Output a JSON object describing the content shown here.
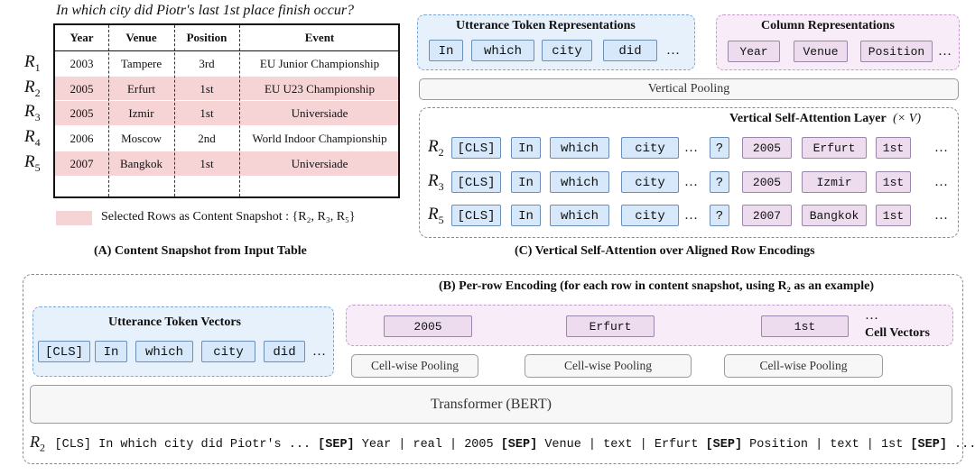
{
  "question": "In which city did Piotr's last 1st place finish occur?",
  "table": {
    "headers": [
      "Year",
      "Venue",
      "Position",
      "Event"
    ],
    "rows": [
      {
        "label": "R",
        "sub": "1",
        "cells": [
          "2003",
          "Tampere",
          "3rd",
          "EU Junior Championship"
        ],
        "selected": false
      },
      {
        "label": "R",
        "sub": "2",
        "cells": [
          "2005",
          "Erfurt",
          "1st",
          "EU U23 Championship"
        ],
        "selected": true
      },
      {
        "label": "R",
        "sub": "3",
        "cells": [
          "2005",
          "Izmir",
          "1st",
          "Universiade"
        ],
        "selected": true
      },
      {
        "label": "R",
        "sub": "4",
        "cells": [
          "2006",
          "Moscow",
          "2nd",
          "World Indoor Championship"
        ],
        "selected": false
      },
      {
        "label": "R",
        "sub": "5",
        "cells": [
          "2007",
          "Bangkok",
          "1st",
          "Universiade"
        ],
        "selected": true
      }
    ]
  },
  "legend_text": "Selected Rows as Content Snapshot : {R₂, R₃, R₅}",
  "caption_a": "(A) Content Snapshot from Input Table",
  "caption_c": "(C) Vertical Self-Attention over Aligned Row Encodings",
  "utterance_reps": {
    "title": "Utterance Token Representations",
    "tokens": [
      "In",
      "which",
      "city",
      "did"
    ],
    "ellipsis": "…"
  },
  "column_reps": {
    "title": "Column Representations",
    "tokens": [
      "Year",
      "Venue",
      "Position"
    ],
    "ellipsis": "…"
  },
  "vertical_pooling": "Vertical Pooling",
  "vsa": {
    "title": "Vertical Self-Attention Layer",
    "times": "(× V)",
    "rows": [
      {
        "label": "R",
        "sub": "2",
        "tokens": [
          "[CLS]",
          "In",
          "which",
          "city"
        ],
        "q": "?",
        "cells": [
          "2005",
          "Erfurt",
          "1st"
        ]
      },
      {
        "label": "R",
        "sub": "3",
        "tokens": [
          "[CLS]",
          "In",
          "which",
          "city"
        ],
        "q": "?",
        "cells": [
          "2005",
          "Izmir",
          "1st"
        ]
      },
      {
        "label": "R",
        "sub": "5",
        "tokens": [
          "[CLS]",
          "In",
          "which",
          "city"
        ],
        "q": "?",
        "cells": [
          "2007",
          "Bangkok",
          "1st"
        ]
      }
    ],
    "ellipsis": "…"
  },
  "per_row": {
    "title": "(B) Per-row Encoding (for each row in content snapshot, using R₂ as an example)",
    "utt_vectors_title": "Utterance Token Vectors",
    "utt_tokens": [
      "[CLS]",
      "In",
      "which",
      "city",
      "did"
    ],
    "cells": [
      "2005",
      "Erfurt",
      "1st"
    ],
    "cell_vectors_label": "Cell Vectors",
    "cell_pooling": "Cell-wise Pooling",
    "transformer": "Transformer (BERT)",
    "seq_label": "R",
    "seq_sub": "2",
    "sequence": [
      {
        "t": "[CLS] In which city did Piotr's ... ",
        "b": false
      },
      {
        "t": "[SEP]",
        "b": true
      },
      {
        "t": " Year | real | 2005 ",
        "b": false
      },
      {
        "t": "[SEP]",
        "b": true
      },
      {
        "t": " Venue | text | Erfurt ",
        "b": false
      },
      {
        "t": "[SEP]",
        "b": true
      },
      {
        "t": " Position | text | 1st ",
        "b": false
      },
      {
        "t": "[SEP]",
        "b": true
      },
      {
        "t": " ...",
        "b": false
      }
    ]
  },
  "colors": {
    "blue_token": "#d6e8fa",
    "purple_token": "#ecdcee",
    "highlight_row": "#f6d4d6"
  }
}
